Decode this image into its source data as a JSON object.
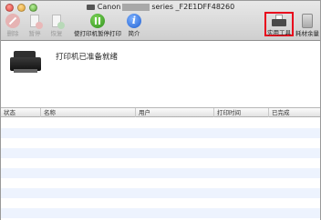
{
  "window": {
    "title_prefix": "Canon",
    "title_suffix": "series _F2E1DFF48260"
  },
  "toolbar": {
    "delete_label": "删除",
    "pause_label": "暂停",
    "resume_label": "恢复",
    "pause_printer_label": "使打印机暂停打印",
    "info_label": "简介",
    "utility_label": "实用工具",
    "ink_label": "耗材余量"
  },
  "status": {
    "message": "打印机已准备就绪"
  },
  "queue": {
    "columns": [
      "状态",
      "名称",
      "用户",
      "打印时间",
      "已完成"
    ],
    "rows": []
  },
  "colors": {
    "highlight_border": "#e8001c",
    "stripe_row": "#edf3fe"
  }
}
